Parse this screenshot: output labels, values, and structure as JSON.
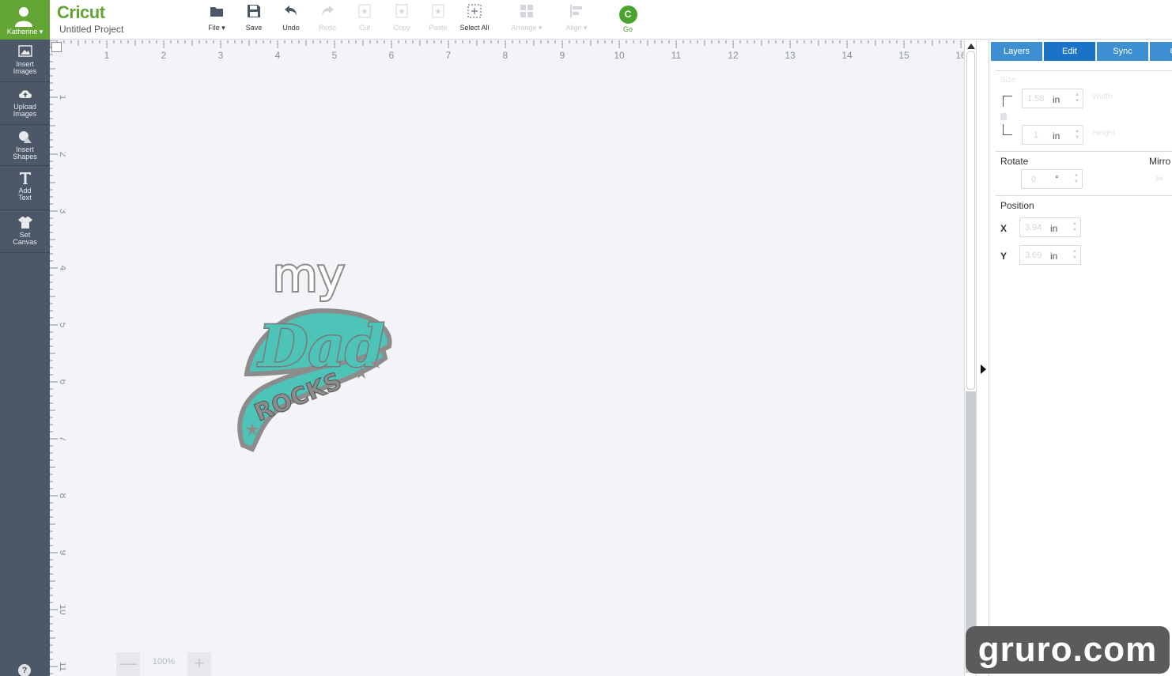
{
  "user": {
    "name": "Katherine"
  },
  "leftnav": {
    "items": [
      {
        "label_line1": "Insert",
        "label_line2": "Images",
        "icon": "image-icon"
      },
      {
        "label_line1": "Upload",
        "label_line2": "Images",
        "icon": "cloud-upload-icon"
      },
      {
        "label_line1": "Insert",
        "label_line2": "Shapes",
        "icon": "shapes-icon"
      },
      {
        "label_line1": "Add",
        "label_line2": "Text",
        "icon": "text-icon"
      },
      {
        "label_line1": "Set",
        "label_line2": "Canvas",
        "icon": "shirt-icon"
      }
    ],
    "help": "?"
  },
  "header": {
    "brand": "Cricut",
    "project_title": "Untitled Project"
  },
  "toolbar": {
    "file": "File",
    "save": "Save",
    "undo": "Undo",
    "redo": "Redo",
    "cut": "Cut",
    "copy": "Copy",
    "paste": "Paste",
    "select_all": "Select All",
    "arrange": "Arrange",
    "align": "Align",
    "go": "Go"
  },
  "rulers": {
    "horizontal": [
      "1",
      "2",
      "3",
      "4",
      "5",
      "6",
      "7",
      "8",
      "9",
      "10",
      "11",
      "12",
      "13",
      "14",
      "15",
      "16"
    ],
    "vertical": [
      "1",
      "2",
      "3",
      "4",
      "5",
      "6",
      "7",
      "8",
      "9",
      "10",
      "11"
    ]
  },
  "design": {
    "line1": "my",
    "line2": "Dad",
    "line3": "ROCKS",
    "accent_color": "#4ec3b8",
    "outline_color": "#8c8c8c"
  },
  "zoom": {
    "value": "100%",
    "minus": "—",
    "plus": "+"
  },
  "panel": {
    "tabs": [
      "Layers",
      "Edit",
      "Sync",
      "Ca"
    ],
    "active_tab": "Edit",
    "size_label": "Size",
    "width": {
      "value": "1.58",
      "unit": "in",
      "label": "Width"
    },
    "height": {
      "value": "1",
      "unit": "in",
      "label": "Height"
    },
    "rotate_label": "Rotate",
    "rotate": {
      "value": "0",
      "unit": "°"
    },
    "mirror_label": "Mirro",
    "position_label": "Position",
    "x": {
      "label": "X",
      "value": "3.94",
      "unit": "in"
    },
    "y": {
      "label": "Y",
      "value": "3.69",
      "unit": "in"
    }
  },
  "watermark": "gruro.com"
}
